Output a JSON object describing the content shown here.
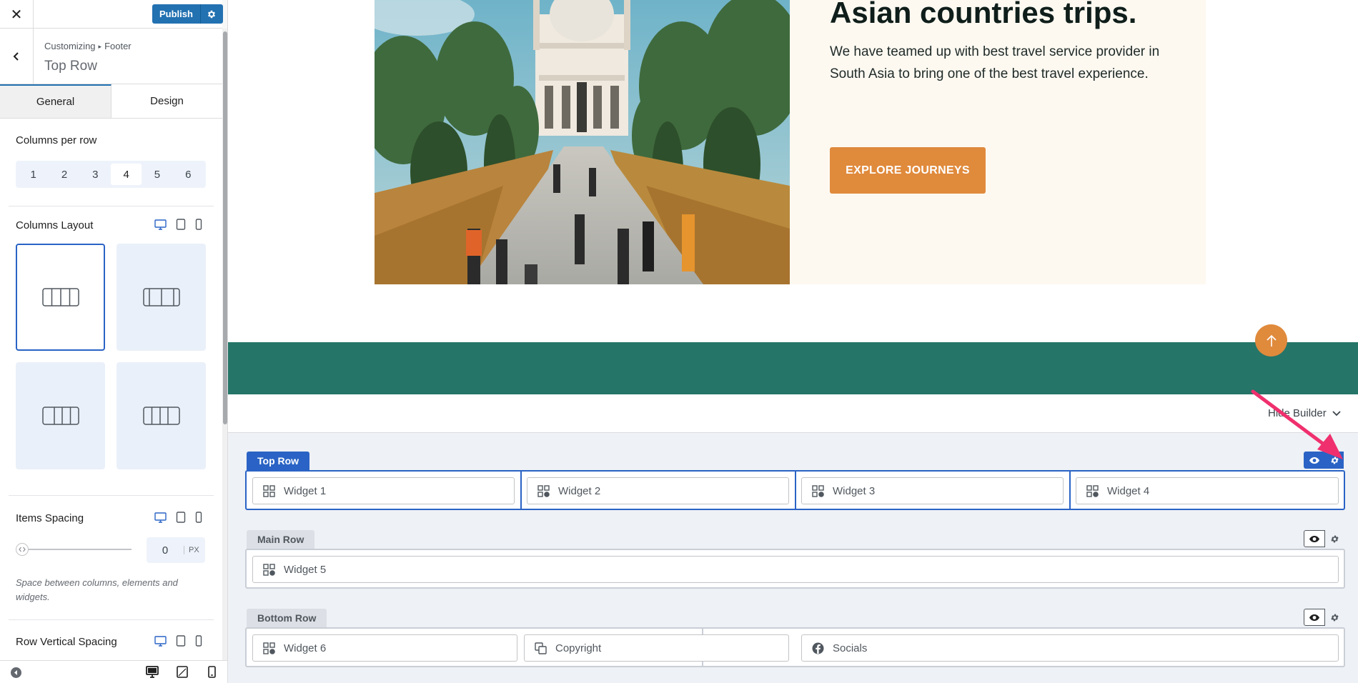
{
  "topbar": {
    "close_label": "✕",
    "publish_label": "Publish"
  },
  "panel": {
    "breadcrumb_root": "Customizing",
    "breadcrumb_sep": "▸",
    "breadcrumb_section": "Footer",
    "title": "Top Row"
  },
  "tabs": [
    {
      "label": "General",
      "active": true
    },
    {
      "label": "Design",
      "active": false
    }
  ],
  "settings": {
    "columns_per_row_label": "Columns per row",
    "columns_options": [
      "1",
      "2",
      "3",
      "4",
      "5",
      "6"
    ],
    "columns_selected": "4",
    "columns_layout_label": "Columns Layout",
    "items_spacing_label": "Items Spacing",
    "items_spacing_value": "0",
    "items_spacing_unit": "PX",
    "items_spacing_help": "Space between columns, elements and widgets.",
    "row_vertical_spacing_label": "Row Vertical Spacing"
  },
  "hero": {
    "title": "Asian countries trips.",
    "text": "We have teamed up with best travel service provider in South Asia to bring one of the best travel experience.",
    "cta_label": "EXPLORE JOURNEYS"
  },
  "builder": {
    "hide_label": "Hide Builder",
    "rows": [
      {
        "name": "Top Row",
        "active": true,
        "widgets": [
          "Widget 1",
          "Widget 2",
          "Widget 3",
          "Widget 4"
        ]
      },
      {
        "name": "Main Row",
        "active": false,
        "widgets": [
          "Widget 5"
        ]
      },
      {
        "name": "Bottom Row",
        "active": false,
        "widgets": [
          "Widget 6",
          "Copyright",
          "Socials"
        ]
      }
    ]
  },
  "colors": {
    "accent": "#2a63c5",
    "publish": "#2271b1",
    "orange": "#e08a3c",
    "teal": "#257568",
    "annotation_arrow": "#f0306e"
  }
}
